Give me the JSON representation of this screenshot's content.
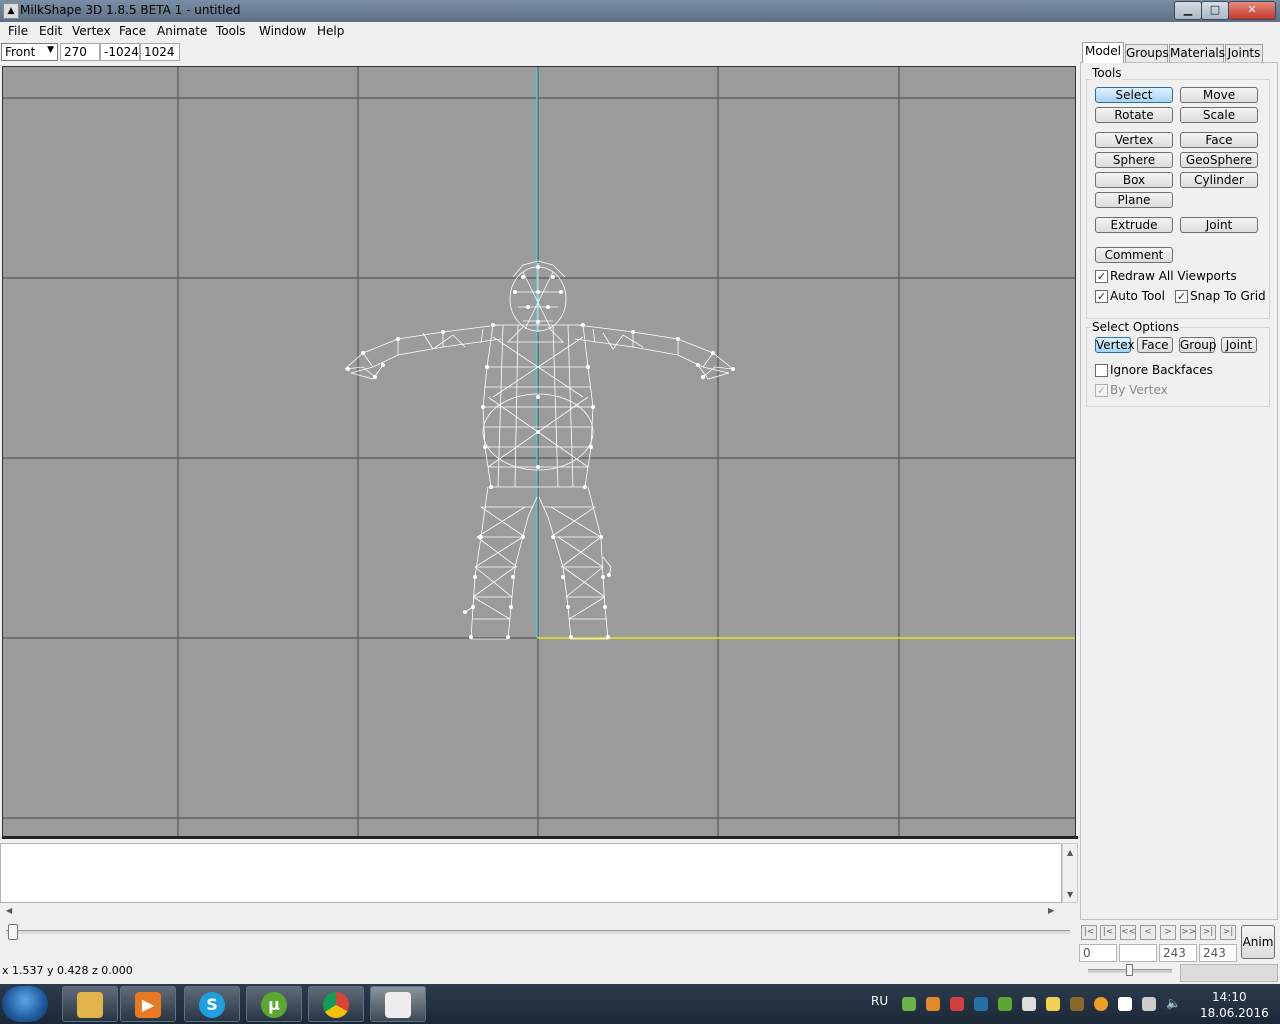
{
  "window": {
    "title": "MilkShape 3D 1.8.5 BETA 1 - untitled",
    "min": "▁",
    "max": "□",
    "close": "✕"
  },
  "menu": [
    "File",
    "Edit",
    "Vertex",
    "Face",
    "Animate",
    "Tools",
    "Window",
    "Help"
  ],
  "viewbar": {
    "view": "Front",
    "x": "270",
    "y": "-1024",
    "z": "1024"
  },
  "panel": {
    "tabs": [
      "Model",
      "Groups",
      "Materials",
      "Joints"
    ],
    "tools_title": "Tools",
    "tools": {
      "select": "Select",
      "move": "Move",
      "rotate": "Rotate",
      "scale": "Scale",
      "vertex": "Vertex",
      "face": "Face",
      "sphere": "Sphere",
      "geosphere": "GeoSphere",
      "box": "Box",
      "cylinder": "Cylinder",
      "plane": "Plane",
      "extrude": "Extrude",
      "joint": "Joint",
      "comment": "Comment"
    },
    "checks": {
      "redraw": {
        "label": "Redraw All Viewports",
        "checked": true
      },
      "autotool": {
        "label": "Auto Tool",
        "checked": true
      },
      "snap": {
        "label": "Snap To Grid",
        "checked": true
      }
    },
    "select_options_title": "Select Options",
    "select_options": [
      "Vertex",
      "Face",
      "Group",
      "Joint"
    ],
    "ignore_backfaces": {
      "label": "Ignore Backfaces",
      "checked": false
    },
    "by_vertex": {
      "label": "By Vertex",
      "checked": true,
      "disabled": true
    }
  },
  "anim": {
    "nav": [
      "|<",
      "|<",
      "<<",
      "<",
      ">",
      ">>",
      ">|",
      ">|"
    ],
    "frame_start": "0",
    "frame_current": "",
    "frame_end_a": "243",
    "frame_end_b": "243",
    "button": "Anim"
  },
  "status": "x 1.537 y 0.428 z 0.000",
  "taskbar": {
    "language": "RU",
    "time": "14:10",
    "date": "18.06.2016"
  }
}
